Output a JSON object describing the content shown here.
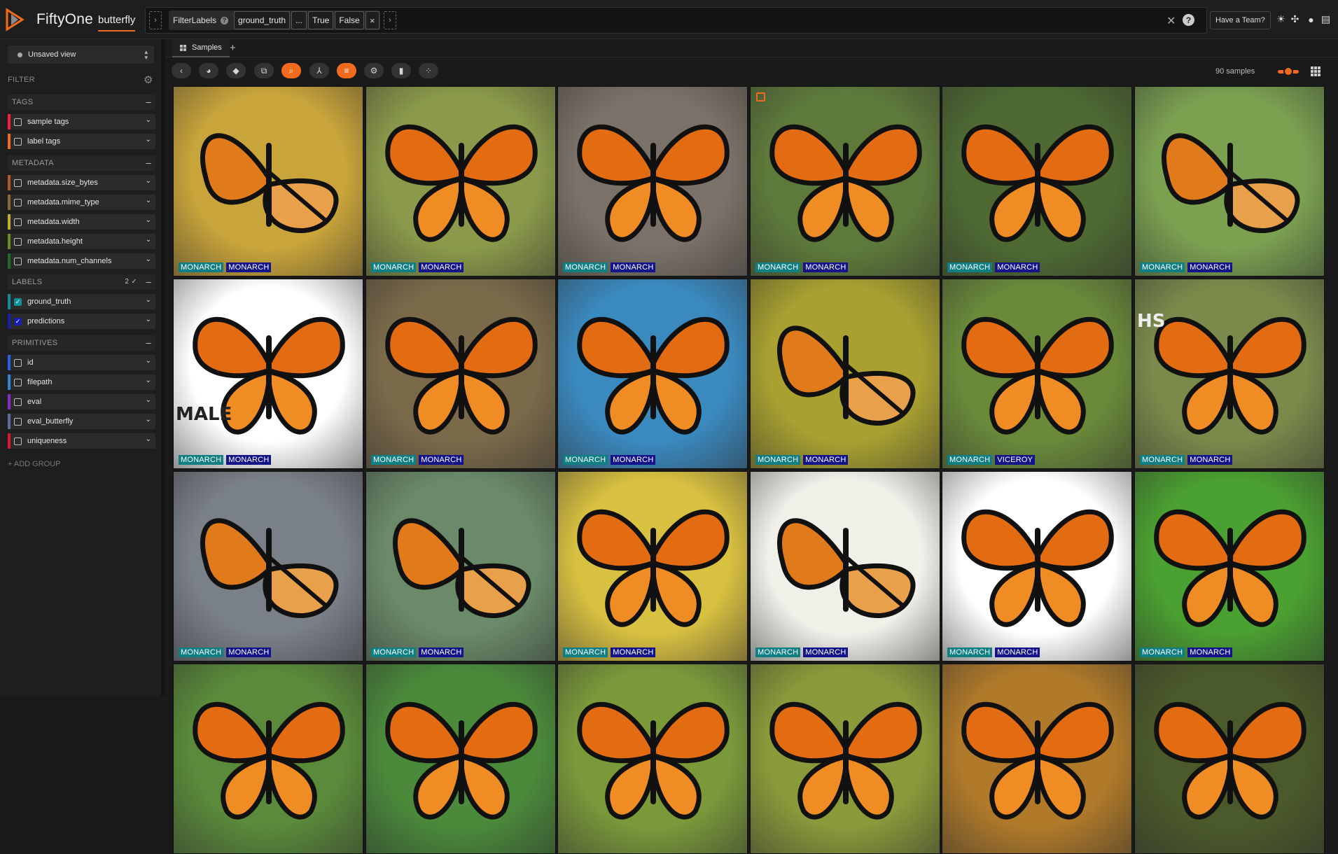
{
  "header": {
    "app_name": "FiftyOne",
    "dataset": "butterfly",
    "team_button": "Have a Team?",
    "icons": [
      "sun-icon",
      "slack-icon",
      "github-icon",
      "book-icon"
    ]
  },
  "view_bar": {
    "stage_name": "FilterLabels",
    "help_glyph": "?",
    "params": [
      "ground_truth",
      "...",
      "True",
      "False"
    ],
    "remove_glyph": "×",
    "close_glyph": "✕",
    "help_button": "?"
  },
  "sidebar": {
    "view_select": "Unsaved view",
    "filter_title": "FILTER",
    "groups": [
      {
        "title": "TAGS",
        "fields": [
          {
            "label": "sample tags",
            "color": "#ff1f3a",
            "checked": false
          },
          {
            "label": "label tags",
            "color": "#f26b1d",
            "checked": false
          }
        ]
      },
      {
        "title": "METADATA",
        "fields": [
          {
            "label": "metadata.size_bytes",
            "color": "#b8542a",
            "checked": false
          },
          {
            "label": "metadata.mime_type",
            "color": "#8a6a2e",
            "checked": false
          },
          {
            "label": "metadata.width",
            "color": "#c0b020",
            "checked": false
          },
          {
            "label": "metadata.height",
            "color": "#6a8f1f",
            "checked": false
          },
          {
            "label": "metadata.num_channels",
            "color": "#1f6b2a",
            "checked": false
          }
        ]
      },
      {
        "title": "LABELS",
        "badge": "2 ✓",
        "fields": [
          {
            "label": "ground_truth",
            "color": "#0f8f94",
            "checked": true
          },
          {
            "label": "predictions",
            "color": "#1620b0",
            "checked": true
          }
        ]
      },
      {
        "title": "PRIMITIVES",
        "fields": [
          {
            "label": "id",
            "color": "#2862e8",
            "checked": false
          },
          {
            "label": "filepath",
            "color": "#2b86d9",
            "checked": false
          },
          {
            "label": "eval",
            "color": "#8a2bc9",
            "checked": false
          },
          {
            "label": "eval_butterfly",
            "color": "#5f6f9a",
            "checked": false
          },
          {
            "label": "uniqueness",
            "color": "#e0182e",
            "checked": false
          }
        ]
      }
    ],
    "add_group": "+ ADD GROUP"
  },
  "tabs": [
    {
      "label": "Samples"
    }
  ],
  "toolbar": {
    "sample_count": "90 samples",
    "tools": [
      "back-icon",
      "palette-icon",
      "tag-icon",
      "patches-icon",
      "search-icon",
      "sort-icon",
      "list-icon",
      "settings-icon",
      "histogram-icon",
      "embeddings-icon"
    ]
  },
  "grid": [
    {
      "bg": "#c9a43a",
      "gt": "MONARCH",
      "pr": "MONARCH",
      "side": true
    },
    {
      "bg": "#8a9a4a",
      "gt": "MONARCH",
      "pr": "MONARCH"
    },
    {
      "bg": "#7a7268",
      "gt": "MONARCH",
      "pr": "MONARCH"
    },
    {
      "bg": "#5e7a3a",
      "gt": "MONARCH",
      "pr": "MONARCH",
      "selected": true
    },
    {
      "bg": "#4e6a32",
      "gt": "MONARCH",
      "pr": "MONARCH"
    },
    {
      "bg": "#7aa050",
      "gt": "MONARCH",
      "pr": "MONARCH",
      "side": true
    },
    {
      "bg": "#ffffff",
      "gt": "MONARCH",
      "pr": "MONARCH",
      "overlay": "MALE"
    },
    {
      "bg": "#7a6a4a",
      "gt": "MONARCH",
      "pr": "MONARCH"
    },
    {
      "bg": "#3a8ac0",
      "gt": "MONARCH",
      "pr": "MONARCH"
    },
    {
      "bg": "#a8a030",
      "gt": "MONARCH",
      "pr": "MONARCH",
      "side": true
    },
    {
      "bg": "#6a8a3a",
      "gt": "MONARCH",
      "pr": "VICEROY"
    },
    {
      "bg": "#7a8a4a",
      "gt": "MONARCH",
      "pr": "MONARCH",
      "overlay": "HS"
    },
    {
      "bg": "#7a8088",
      "gt": "MONARCH",
      "pr": "MONARCH",
      "side": true
    },
    {
      "bg": "#6a8a6a",
      "gt": "MONARCH",
      "pr": "MONARCH",
      "side": true
    },
    {
      "bg": "#d8c040",
      "gt": "MONARCH",
      "pr": "MONARCH"
    },
    {
      "bg": "#f0efe8",
      "gt": "MONARCH",
      "pr": "MONARCH",
      "side": true
    },
    {
      "bg": "#ffffff",
      "gt": "MONARCH",
      "pr": "MONARCH"
    },
    {
      "bg": "#4aa030",
      "gt": "MONARCH",
      "pr": "MONARCH"
    },
    {
      "bg": "#5a8a3a"
    },
    {
      "bg": "#4a8a3a"
    },
    {
      "bg": "#7a9a3a"
    },
    {
      "bg": "#8a9a3a"
    },
    {
      "bg": "#b07a2a"
    },
    {
      "bg": "#4a5a2a"
    }
  ]
}
